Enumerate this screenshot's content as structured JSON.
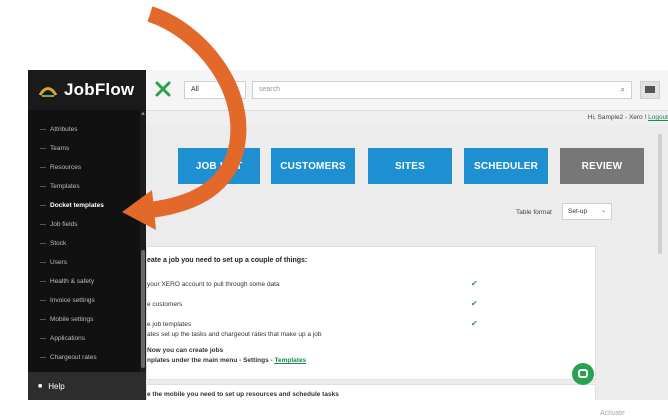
{
  "app": {
    "name": "JobFlow"
  },
  "sidebar": {
    "items": [
      {
        "label": "Attributes"
      },
      {
        "label": "Teams"
      },
      {
        "label": "Resources"
      },
      {
        "label": "Templates"
      },
      {
        "label": "Docket templates",
        "active": true
      },
      {
        "label": "Job fields"
      },
      {
        "label": "Stock"
      },
      {
        "label": "Users"
      },
      {
        "label": "Health & safety"
      },
      {
        "label": "Invoice settings"
      },
      {
        "label": "Mobile settings"
      },
      {
        "label": "Applications"
      },
      {
        "label": "Chargeout rates"
      }
    ],
    "help_label": "Help"
  },
  "topbar": {
    "filter_value": "All",
    "search_placeholder": "search"
  },
  "user": {
    "greeting": "Hi, Sample2 - Xero !",
    "logout_label": "Logout"
  },
  "nav": {
    "buttons": [
      {
        "label": "JOB LIST",
        "color": "#1e90d2"
      },
      {
        "label": "CUSTOMERS",
        "color": "#1e90d2"
      },
      {
        "label": "SITES",
        "color": "#1e90d2"
      },
      {
        "label": "SCHEDULER",
        "color": "#1e90d2"
      },
      {
        "label": "REVIEW",
        "color": "#777777"
      }
    ]
  },
  "table_format": {
    "label": "Table format",
    "value": "Set-up"
  },
  "setup_card": {
    "title": "eate a job you need to set up a couple of things:",
    "row1": "your XERO account to pull through some data",
    "row2": "e customers",
    "row3a": "e job templates",
    "row3b": "ates set up the tasks and chargeout rates that make up a job",
    "row4": "Now you can create jobs",
    "row5_prefix": "nplates under the main menu - Settings -",
    "row5_link": "Templates"
  },
  "mobile_card": {
    "title": "e the mobile you need to set up resources and schedule tasks"
  },
  "footer_text": "Activate",
  "colors": {
    "accent": "#29a14f",
    "arrow": "#e2692a",
    "sidebar": "#111111",
    "nav_blue": "#1e90d2"
  },
  "icons": {
    "filter": "chevron-down-icon",
    "search": "search-icon",
    "chat": "chat-icon",
    "close": "x-icon",
    "help": "help-icon"
  }
}
